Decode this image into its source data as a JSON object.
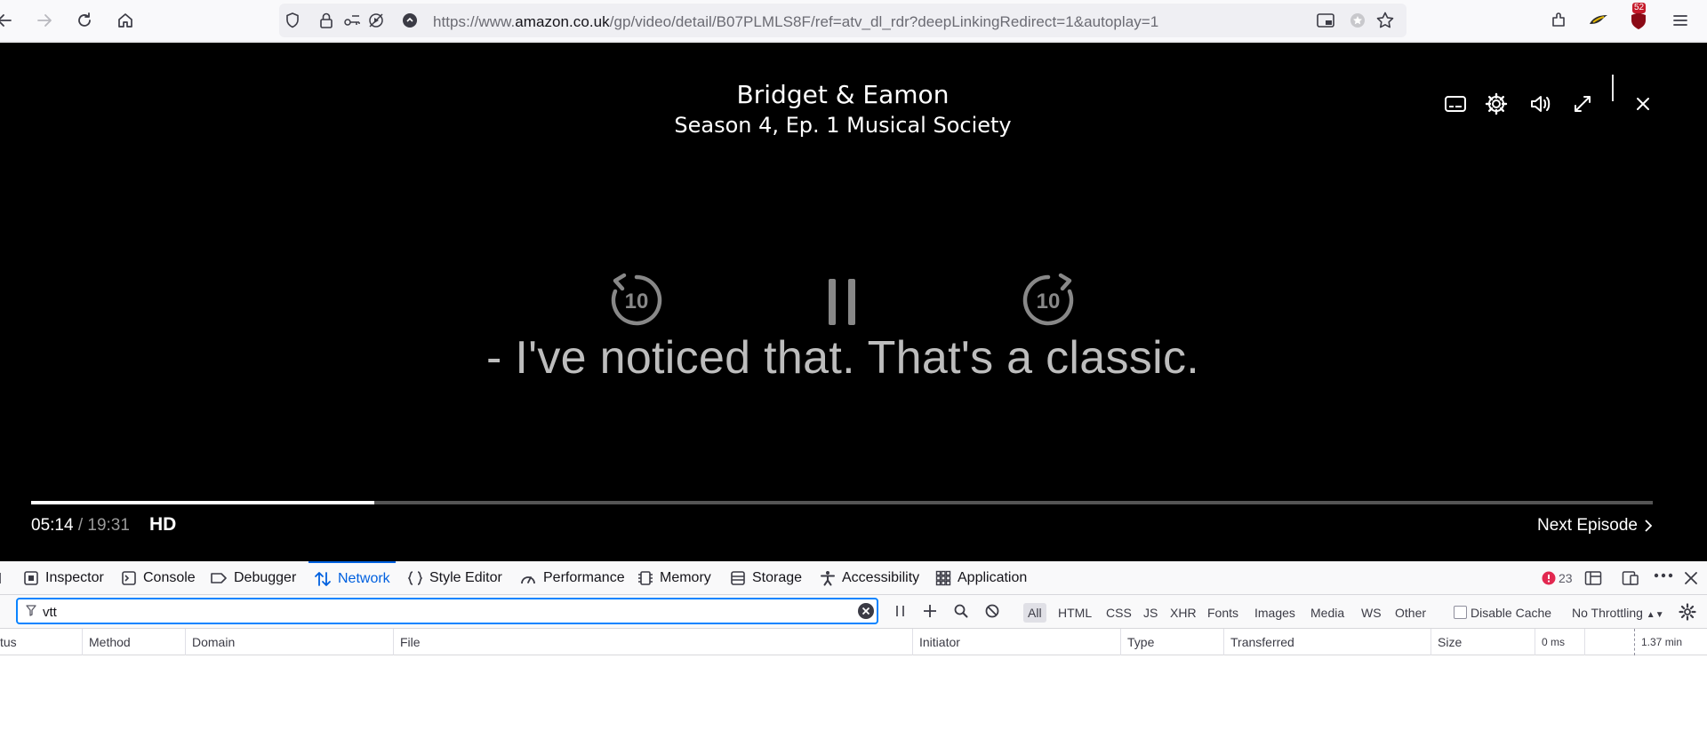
{
  "browser": {
    "url_prefix": "https://www.",
    "url_domain": "amazon.co.uk",
    "url_path": "/gp/video/detail/B07PLMLS8F/ref=atv_dl_rdr?deepLinkingRedirect=1&autoplay=1",
    "extension_badge": "52",
    "icons": [
      "back-arrow-icon",
      "forward-arrow-icon",
      "reload-icon",
      "home-icon",
      "shield-icon",
      "lock-icon",
      "permissions-icon",
      "autoplay-blocked-icon",
      "site-info-icon",
      "picture-in-picture-icon",
      "extension-icon",
      "bookmark-star-icon",
      "extensions-icon",
      "menu-icon"
    ]
  },
  "player": {
    "show_title": "Bridget & Eamon",
    "episode_title": "Season 4, Ep. 1 Musical Society",
    "subtitle_line": "- I've noticed that. That's a classic.",
    "rewind_label": "10",
    "forward_label": "10",
    "current_time": "05:14",
    "separator": " / ",
    "total_time": "19:31",
    "quality": "HD",
    "next_episode_label": "Next Episode",
    "progress_fraction": 0.2118,
    "icons": [
      "subtitles-icon",
      "settings-gear-icon",
      "volume-icon",
      "fullscreen-icon",
      "close-icon"
    ]
  },
  "devtools": {
    "tabs": [
      {
        "label": "Inspector",
        "icon": "inspector-icon"
      },
      {
        "label": "Console",
        "icon": "console-icon"
      },
      {
        "label": "Debugger",
        "icon": "debugger-icon"
      },
      {
        "label": "Network",
        "icon": "network-icon",
        "active": true
      },
      {
        "label": "Style Editor",
        "icon": "style-editor-icon"
      },
      {
        "label": "Performance",
        "icon": "performance-icon"
      },
      {
        "label": "Memory",
        "icon": "memory-icon"
      },
      {
        "label": "Storage",
        "icon": "storage-icon"
      },
      {
        "label": "Accessibility",
        "icon": "accessibility-icon"
      },
      {
        "label": "Application",
        "icon": "application-icon"
      }
    ],
    "error_count": "23",
    "filter_value": "vtt",
    "filter_types": [
      "All",
      "HTML",
      "CSS",
      "JS",
      "XHR",
      "Fonts",
      "Images",
      "Media",
      "WS",
      "Other"
    ],
    "active_filter_type": "All",
    "disable_cache_label": "Disable Cache",
    "disable_cache_checked": false,
    "throttling_label": "No Throttling",
    "columns": [
      "tus",
      "Method",
      "Domain",
      "File",
      "Initiator",
      "Type",
      "Transferred",
      "Size",
      "0 ms",
      "1.37 min"
    ]
  }
}
